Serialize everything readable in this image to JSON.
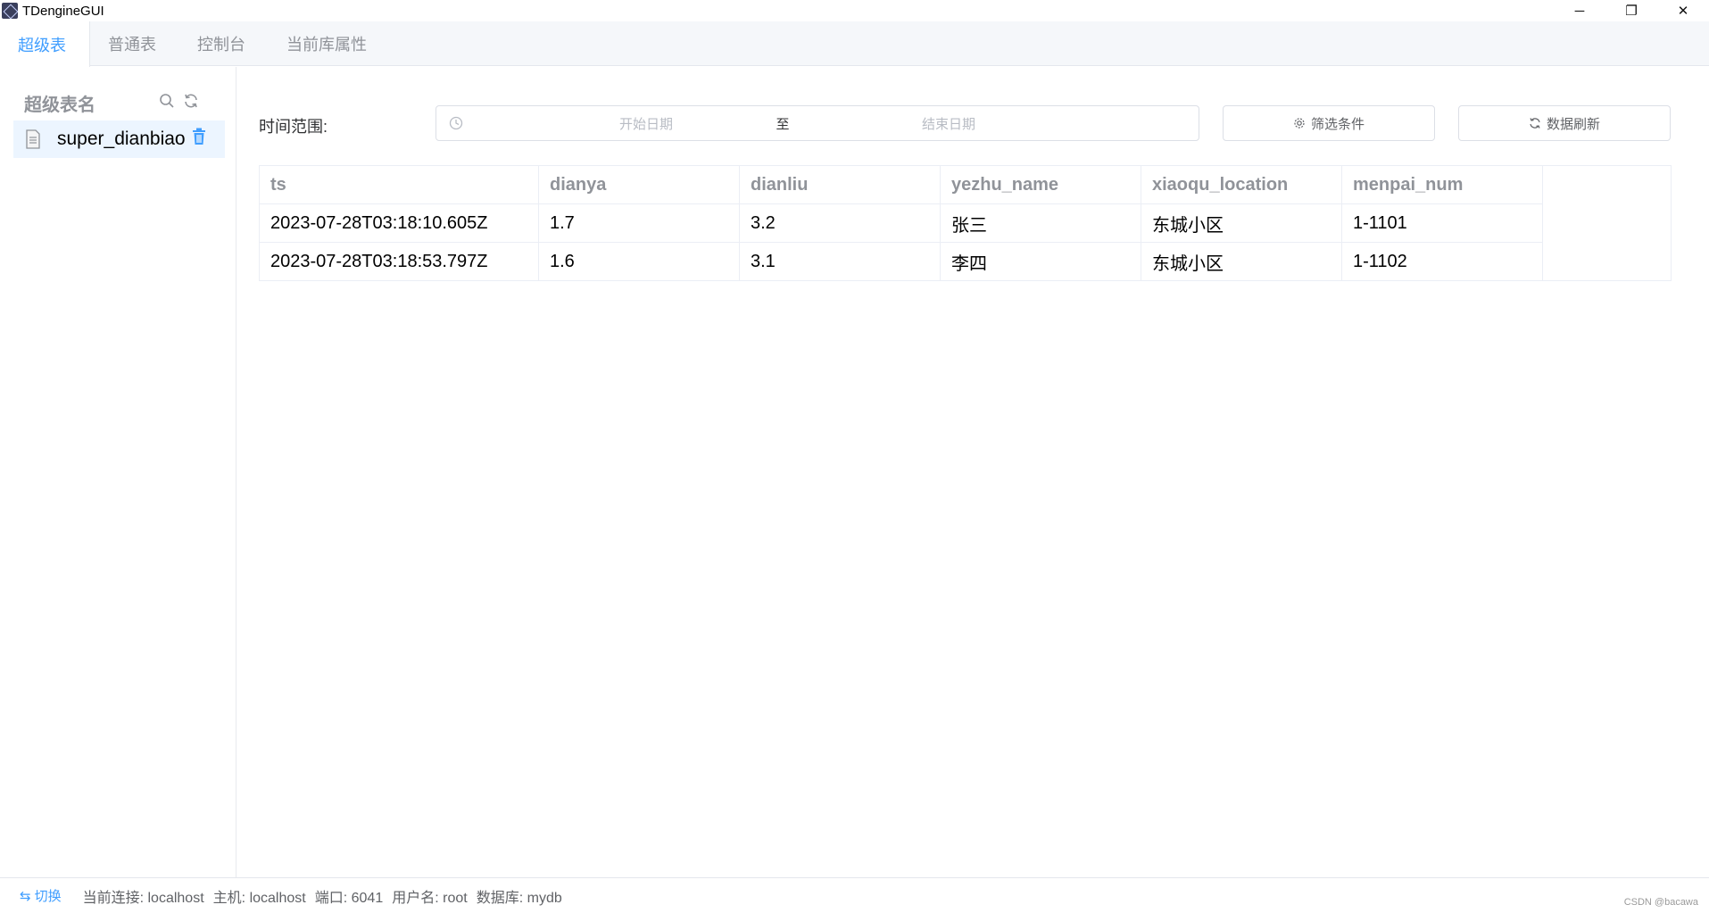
{
  "window": {
    "title": "TDengineGUI",
    "controls": {
      "minimize": "─",
      "restore": "❐",
      "close": "✕"
    }
  },
  "tabs": [
    {
      "label": "超级表",
      "active": true
    },
    {
      "label": "普通表",
      "active": false
    },
    {
      "label": "控制台",
      "active": false
    },
    {
      "label": "当前库属性",
      "active": false
    }
  ],
  "sidebar": {
    "title": "超级表名",
    "items": [
      {
        "label": "super_dianbiao"
      }
    ]
  },
  "toolbar": {
    "time_range_label": "时间范围:",
    "start_placeholder": "开始日期",
    "separator": "至",
    "end_placeholder": "结束日期",
    "filter_label": "筛选条件",
    "refresh_label": "数据刷新"
  },
  "table": {
    "columns": [
      "ts",
      "dianya",
      "dianliu",
      "yezhu_name",
      "xiaoqu_location",
      "menpai_num"
    ],
    "rows": [
      [
        "2023-07-28T03:18:10.605Z",
        "1.7",
        "3.2",
        "张三",
        "东城小区",
        "1-1101"
      ],
      [
        "2023-07-28T03:18:53.797Z",
        "1.6",
        "3.1",
        "李四",
        "东城小区",
        "1-1102"
      ]
    ]
  },
  "status": {
    "switch_label": "切换",
    "connection_label": "当前连接:",
    "connection": "localhost",
    "host_label": "主机:",
    "host": "localhost",
    "port_label": "端口:",
    "port": "6041",
    "user_label": "用户名:",
    "user": "root",
    "db_label": "数据库:",
    "db": "mydb",
    "watermark": "CSDN @bacawa"
  },
  "colors": {
    "accent": "#409eff",
    "header_text": "#909399",
    "border": "#ebeef5"
  }
}
